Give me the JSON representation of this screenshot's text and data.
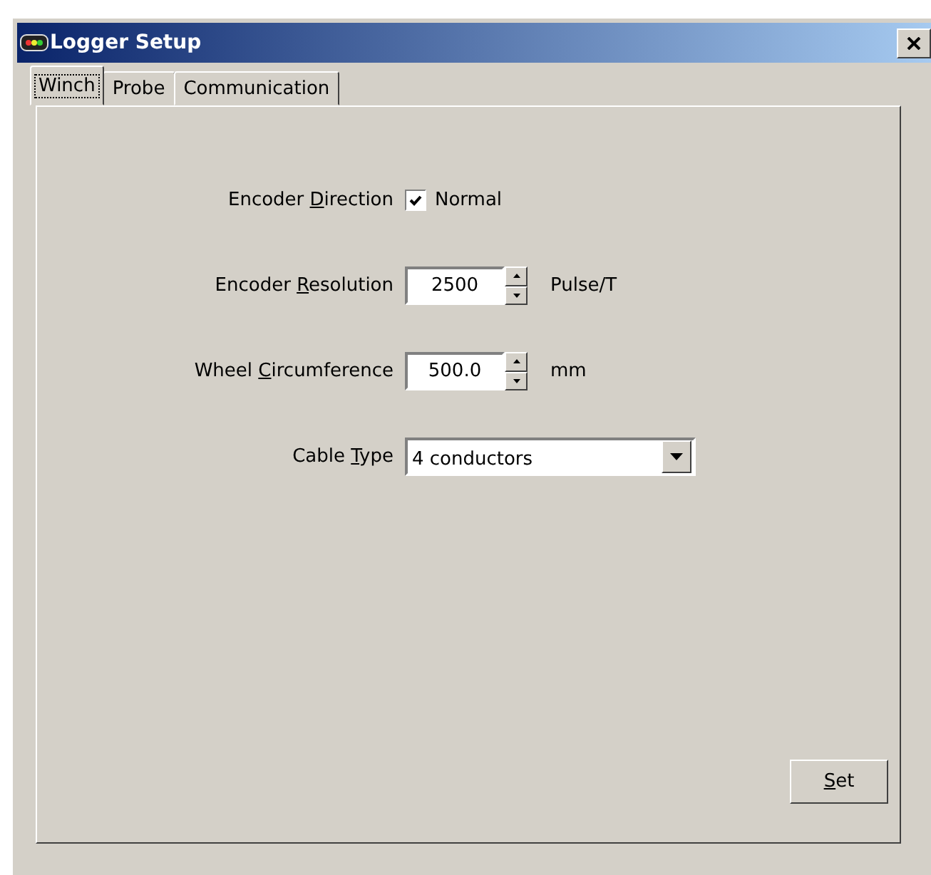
{
  "window": {
    "title": "Logger Setup"
  },
  "tabs": [
    {
      "label": "Winch",
      "selected": true
    },
    {
      "label": "Probe",
      "selected": false
    },
    {
      "label": "Communication",
      "selected": false
    }
  ],
  "fields": [
    {
      "kind": "checkbox",
      "label": [
        "Encoder ",
        "D",
        "irection"
      ],
      "value": "Normal",
      "checked": true
    },
    {
      "kind": "spin",
      "label": [
        "Encoder ",
        "R",
        "esolution"
      ],
      "value": "2500",
      "unit": "Pulse/T"
    },
    {
      "kind": "spin",
      "label": [
        "Wheel ",
        "C",
        "ircumference"
      ],
      "value": "500.0",
      "unit": "mm"
    },
    {
      "kind": "dropdown",
      "label": [
        "Cable ",
        "T",
        "ype"
      ],
      "value": "4 conductors"
    }
  ],
  "set_button": {
    "mnemonic": "S",
    "rest": "et"
  }
}
